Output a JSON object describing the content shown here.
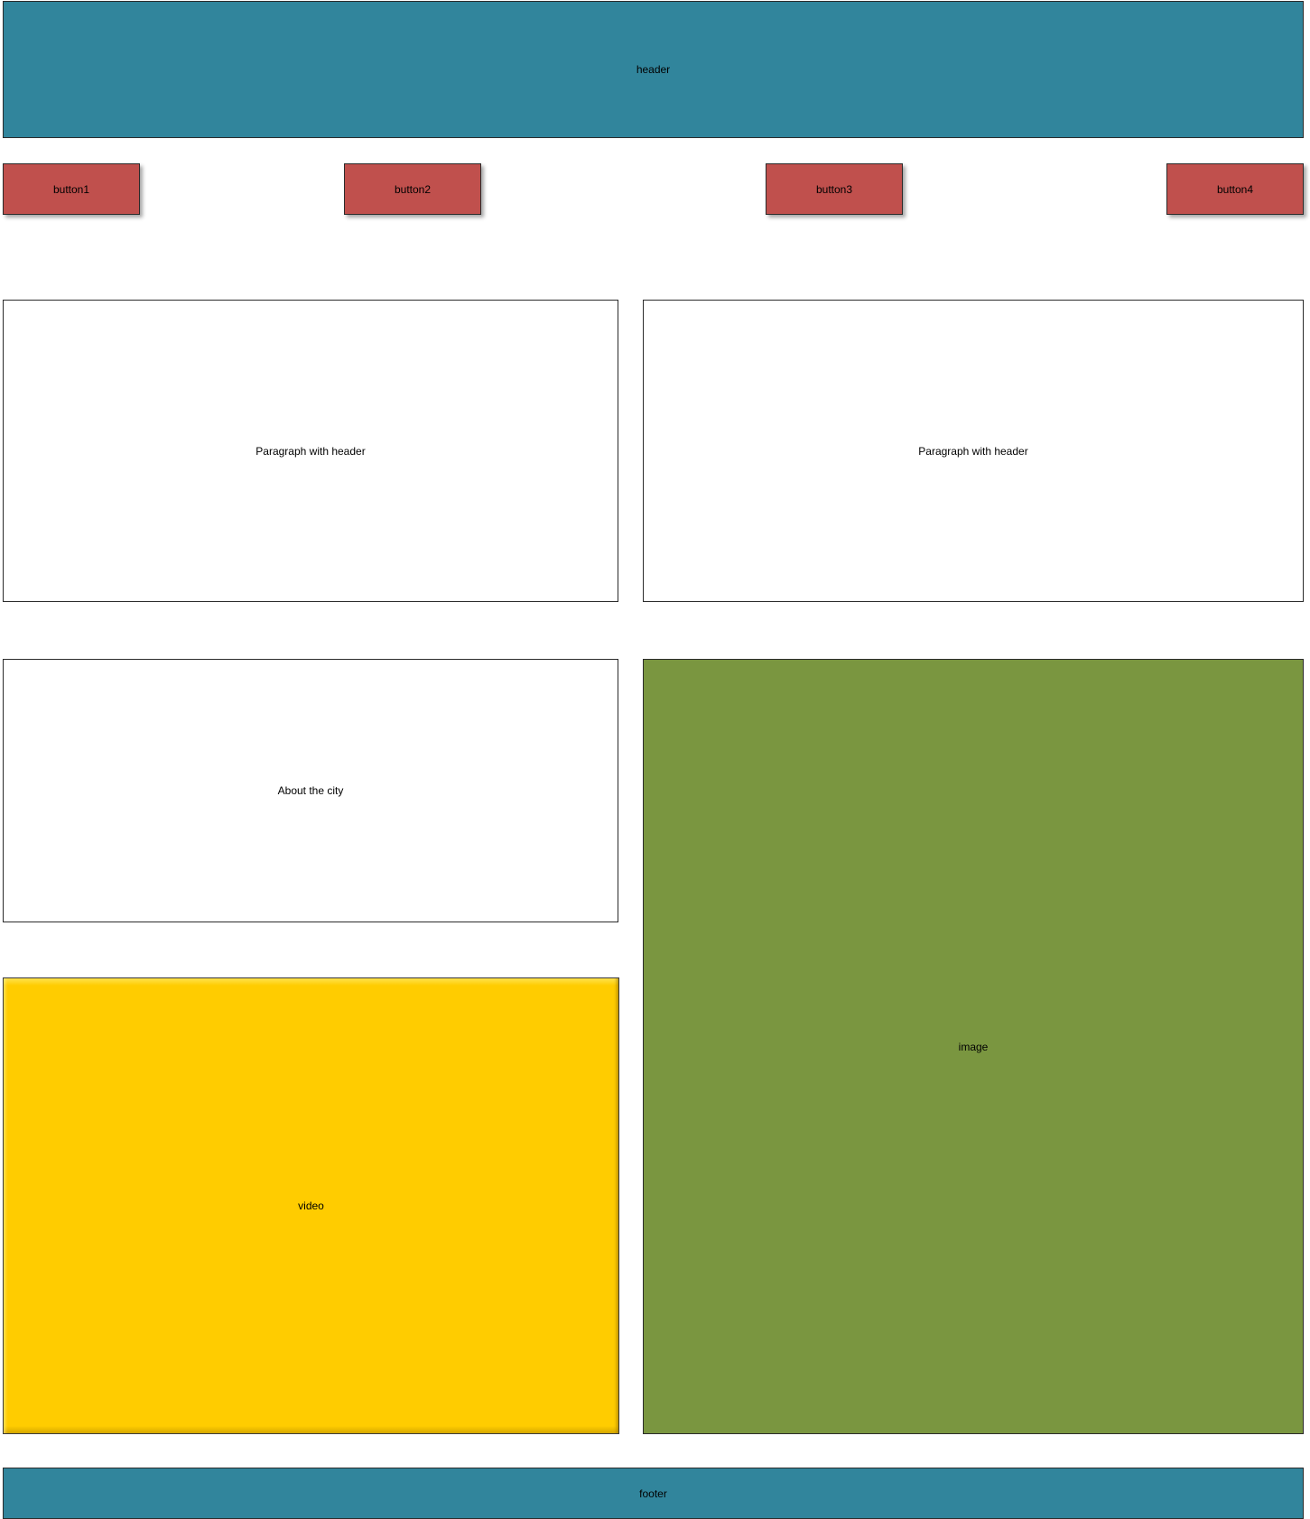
{
  "header": {
    "label": "header"
  },
  "nav": {
    "buttons": [
      {
        "label": "button1"
      },
      {
        "label": "button2"
      },
      {
        "label": "button3"
      },
      {
        "label": "button4"
      }
    ]
  },
  "content": {
    "paragraph_left": "Paragraph with header",
    "paragraph_right": "Paragraph with header",
    "about": "About the city",
    "video": "video",
    "image": "image"
  },
  "footer": {
    "label": "footer"
  },
  "colors": {
    "header_footer": "#31859c",
    "button": "#c0504d",
    "video": "#ffcc00",
    "image": "#7a9640"
  }
}
